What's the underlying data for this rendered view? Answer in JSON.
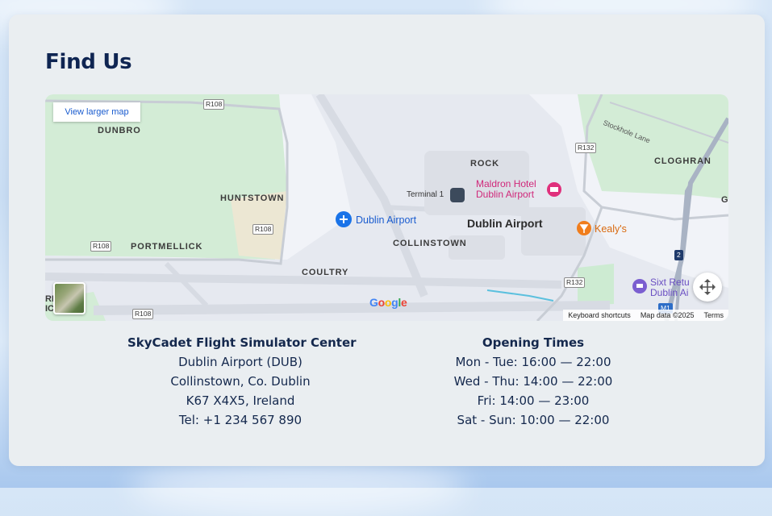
{
  "section": {
    "title": "Find Us"
  },
  "map": {
    "view_larger_label": "View larger map",
    "place_labels": {
      "dunbro": "DUNBRO",
      "huntstown": "HUNTSTOWN",
      "portmellick": "PORTMELLICK",
      "coultry": "COULTRY",
      "collinstown": "COLLINSTOWN",
      "rock": "ROCK",
      "cloghran": "CLOGHRAN",
      "dublin_airport_area": "Dublin Airport",
      "stockhole_lane": "Stockhole Lane",
      "partial_left": "RI\nICPARK",
      "partial_right": "G"
    },
    "road_labels": {
      "r108_top": "R108",
      "r108_mid": "R108",
      "r108_left": "R108",
      "r108_bottom": "R108",
      "r132_top": "R132",
      "r132_bottom": "R132",
      "m1": "M1",
      "two": "2"
    },
    "pois": {
      "dublin_airport_pin": "Dublin Airport",
      "terminal1": "Terminal 1",
      "maldron_line1": "Maldron Hotel",
      "maldron_line2": "Dublin Airport",
      "kealys": "Kealy's",
      "sixt_line1": "Sixt Retu",
      "sixt_line2": "Dublin Ai"
    },
    "logo_letters": [
      "G",
      "o",
      "o",
      "g",
      "l",
      "e"
    ],
    "footer": {
      "shortcuts": "Keyboard shortcuts",
      "map_data": "Map data ©2025",
      "terms": "Terms"
    },
    "colors": {
      "water": "#5bc0de",
      "park": "#cdebd2",
      "road": "#c9ced6",
      "pin_blue": "#1a73e8",
      "poi_pink": "#e0307c",
      "poi_orange": "#f07d1c",
      "poi_purple": "#7b5fd0"
    }
  },
  "address": {
    "name": "SkyCadet Flight Simulator Center",
    "line1": "Dublin Airport (DUB)",
    "line2": "Collinstown, Co. Dublin",
    "line3": "K67 X4X5, Ireland",
    "phone": "Tel: +1 234 567 890"
  },
  "opening": {
    "title": "Opening Times",
    "mon_tue": "Mon - Tue: 16:00 — 22:00",
    "wed_thu": "Wed - Thu: 14:00 — 22:00",
    "fri": "Fri: 14:00 — 23:00",
    "sat_sun": "Sat - Sun: 10:00 — 22:00"
  }
}
